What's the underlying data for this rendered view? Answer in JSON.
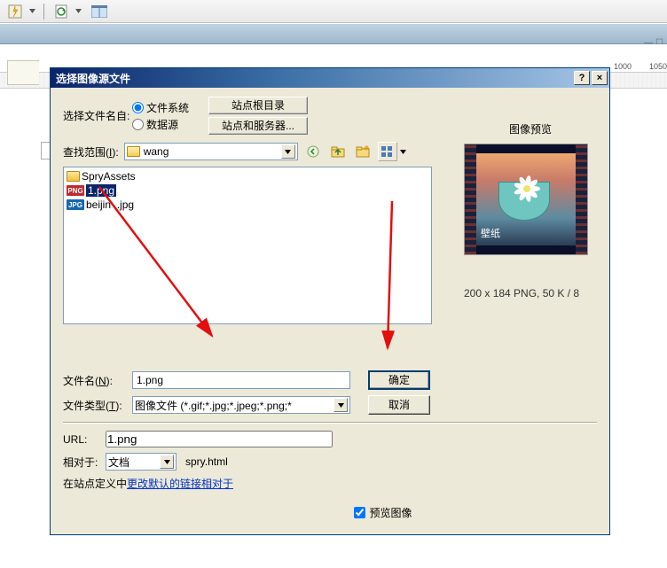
{
  "ruler": {
    "tick1": "1000",
    "tick2": "1050"
  },
  "dialog": {
    "title": "选择图像源文件",
    "help": "?",
    "close": "×",
    "select_from_label": "选择文件名自:",
    "radio_fs": "文件系统",
    "radio_db": "数据源",
    "btn_site_root": "站点根目录",
    "btn_site_server": "站点和服务器...",
    "look_in_label_pre": "查找范围(",
    "look_in_label_key": "I",
    "look_in_label_post": "):",
    "look_in_value": "wang",
    "files": {
      "folder": "SpryAssets",
      "png_label": "PNG",
      "file1": "1.png",
      "jpg_label": "JPG",
      "file2": "beijing.jpg",
      "file2_a": "beijin",
      "file2_b": ".jpg"
    },
    "filename_label_pre": "文件名(",
    "filename_label_key": "N",
    "filename_label_post": "):",
    "filename_value": "1.png",
    "filetype_label_pre": "文件类型(",
    "filetype_label_key": "T",
    "filetype_label_post": "):",
    "filetype_value": "图像文件 (*.gif;*.jpg;*.jpeg;*.png;*",
    "ok": "确定",
    "cancel": "取消",
    "url_label": "URL:",
    "url_value": "1.png",
    "relative_label": "相对于:",
    "relative_value": "文档",
    "relative_file": "spry.html",
    "note_pre": "在站点定义中",
    "note_link": "更改默认的链接相对于",
    "preview_check": "预览图像"
  },
  "preview": {
    "title": "图像预览",
    "inner_label": "壁纸",
    "info": "200 x 184 PNG, 50 K / 8"
  }
}
